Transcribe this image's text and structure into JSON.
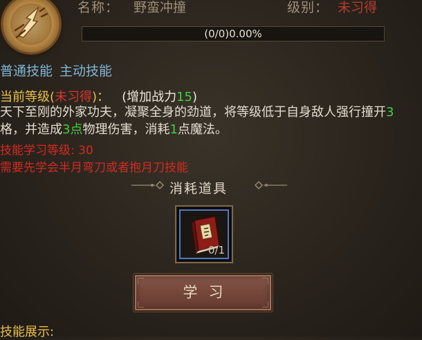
{
  "header": {
    "name_label": "名称：",
    "name_value": "野蛮冲撞",
    "level_label": "级别：",
    "level_value": "未习得"
  },
  "progress": {
    "text": "(0/0)0.00%",
    "fraction": 0
  },
  "tags": [
    "普通技能",
    "主动技能"
  ],
  "current_level": {
    "prefix": "当前等级",
    "paren_open": "(",
    "status": "未习得",
    "paren_close": ")：",
    "power_prefix": "(增加战力",
    "power_value": "15",
    "power_suffix": ")"
  },
  "description": {
    "p1": "天下至刚的外家功夫，凝聚全身的劲道，将等级低于自身敌人强行撞开",
    "n1": "3",
    "p2": "格，并造成",
    "n2": "3点",
    "p3": "物理伤害，消耗",
    "n3": "1",
    "p4": "点魔法。"
  },
  "requirements": {
    "learn_level": "技能学习等级: 30",
    "prereq": "需要先学会半月弯刀或者抱月刀技能"
  },
  "consume": {
    "title": "消耗道具",
    "item_icon": "red-skill-book-icon",
    "item_count": "0/1"
  },
  "learn_button": {
    "label": "学习"
  },
  "showcase": {
    "label": "技能展示:"
  },
  "colors": {
    "accent_red": "#d8362c",
    "accent_yellow": "#e8c14a",
    "accent_green": "#40d040",
    "tag_blue": "#7fb5d6"
  }
}
